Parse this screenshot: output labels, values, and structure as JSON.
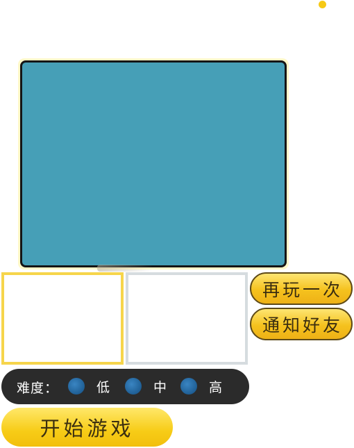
{
  "colors": {
    "board": "#469fb7",
    "board_border": "#151515",
    "accent_yellow": "#f6c915",
    "thumb_selected_border": "#f6d54b",
    "thumb_border": "#d6dcdf",
    "difficulty_bar": "#2b2b2b",
    "radio": "#1f5f95"
  },
  "side_buttons": {
    "replay_label": "再玩一次",
    "notify_label": "通知好友"
  },
  "difficulty": {
    "label": "难度：",
    "options": [
      {
        "label": "低",
        "icon": "radio-circle-icon"
      },
      {
        "label": "中",
        "icon": "radio-circle-icon"
      },
      {
        "label": "高",
        "icon": "radio-circle-icon"
      }
    ]
  },
  "start_button": {
    "label": "开始游戏"
  }
}
